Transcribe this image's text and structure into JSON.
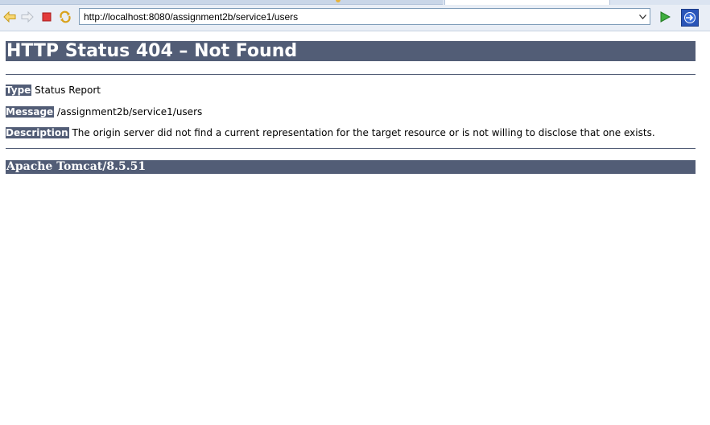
{
  "browser": {
    "url": "http://localhost:8080/assignment2b/service1/users",
    "icons": [
      "back-icon",
      "forward-icon",
      "stop-icon",
      "refresh-icon",
      "chevron-down-icon",
      "go-icon",
      "external-browser-icon"
    ]
  },
  "page": {
    "title": "HTTP Status 404 – Not Found",
    "type_label": "Type",
    "type_value": "Status Report",
    "message_label": "Message",
    "message_value": "/assignment2b/service1/users",
    "description_label": "Description",
    "description_value": "The origin server did not find a current representation for the target resource or is not willing to disclose that one exists.",
    "footer": "Apache Tomcat/8.5.51"
  },
  "colors": {
    "tomcat_band": "#525d76",
    "toolbar_bg": "#e9eef6"
  }
}
